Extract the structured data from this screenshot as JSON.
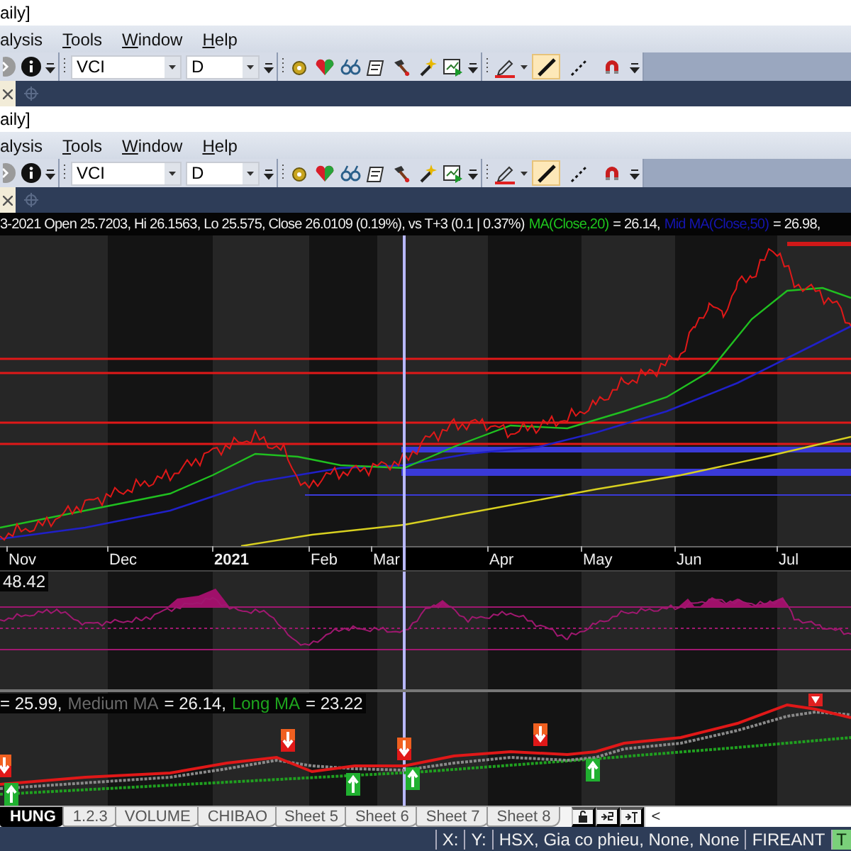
{
  "windows": [
    {
      "title": "aily]",
      "menu": [
        "alysis",
        "Tools",
        "Window",
        "Help"
      ],
      "symbol": "VCI",
      "interval": "D",
      "tools": [
        {
          "kind": "line",
          "selected": true
        },
        {
          "kind": "dotted-line",
          "selected": false
        },
        {
          "kind": "magnet",
          "selected": false
        }
      ]
    },
    {
      "title": "aily]",
      "menu": [
        "alysis",
        "Tools",
        "Window",
        "Help"
      ],
      "symbol": "VCI",
      "interval": "D",
      "tools": [
        {
          "kind": "line",
          "selected": true
        },
        {
          "kind": "dotted-line",
          "selected": false
        },
        {
          "kind": "magnet",
          "selected": false
        }
      ]
    }
  ],
  "chart": {
    "quote": "3-2021 Open 25.7203, Hi 26.1563, Lo 25.575, Close 26.0109 (0.19%), vs T+3 (0.1 | 0.37%)",
    "ma_label": "MA(Close,20)",
    "ma_value": "= 26.14,",
    "mid_label": "Mid MA(Close,50)",
    "mid_value": "= 26.98,",
    "months": [
      {
        "label": "Nov",
        "year": false
      },
      {
        "label": "Dec",
        "year": false
      },
      {
        "label": "2021",
        "year": true
      },
      {
        "label": "Feb",
        "year": false
      },
      {
        "label": "Mar",
        "year": false
      },
      {
        "label": "Apr",
        "year": false
      },
      {
        "label": "May",
        "year": false
      },
      {
        "label": "Jun",
        "year": false
      },
      {
        "label": "Jul",
        "year": false
      }
    ]
  },
  "indicator": {
    "value": "48.42"
  },
  "signals_pane": {
    "short_value": "= 25.99,",
    "medium_label": "Medium MA",
    "medium_value": "= 26.14,",
    "long_label": "Long MA",
    "long_value": "= 23.22"
  },
  "sheets": [
    {
      "label": "HUNG",
      "selected": true
    },
    {
      "label": "1.2.3",
      "selected": false
    },
    {
      "label": "VOLUME",
      "selected": false
    },
    {
      "label": "CHIBAO",
      "selected": false
    },
    {
      "label": "Sheet 5",
      "selected": false
    },
    {
      "label": "Sheet 6",
      "selected": false
    },
    {
      "label": "Sheet 7",
      "selected": false
    },
    {
      "label": "Sheet 8",
      "selected": false
    }
  ],
  "scroll_left": "<",
  "status": [
    "X:",
    "Y:",
    "HSX, Gia co phieu, None, None",
    "FIREANT",
    "T"
  ]
}
